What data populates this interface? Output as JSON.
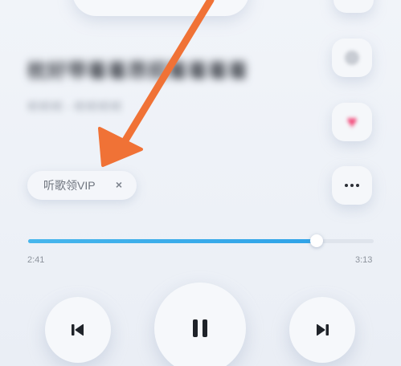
{
  "song": {
    "title": "枕好带着着昂招着着着着",
    "artist": "听听听 - 听听听听"
  },
  "vip_chip": {
    "label": "听歌领VIP",
    "close": "×"
  },
  "progress": {
    "elapsed": "2:41",
    "duration": "3:13",
    "fraction": 0.836
  },
  "icons": {
    "share": "share-icon",
    "favorite": "heart-icon",
    "more": "more-dots-icon",
    "previous": "previous-track-icon",
    "play_pause": "pause-icon",
    "next": "next-track-icon"
  },
  "colors": {
    "accent": "#2fa3e8",
    "favorite": "#f24b7a",
    "annotation_arrow": "#f07236"
  }
}
